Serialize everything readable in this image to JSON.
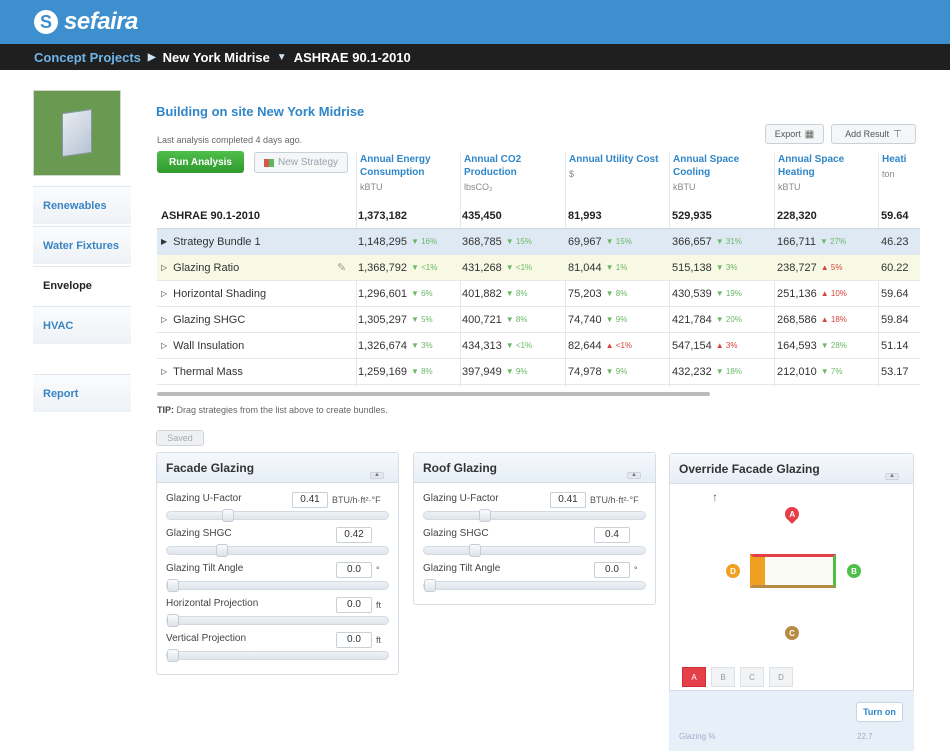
{
  "brand": {
    "name": "sefaira",
    "logo_glyph": "S"
  },
  "breadcrumb": {
    "root": "Concept Projects",
    "project": "New York Midrise",
    "standard": "ASHRAE 90.1-2010",
    "sep": "▶",
    "dropdown": "▼"
  },
  "sidebar": {
    "items": [
      {
        "label": "Renewables",
        "active": false
      },
      {
        "label": "Water Fixtures",
        "active": false
      },
      {
        "label": "Envelope",
        "active": true
      },
      {
        "label": "HVAC",
        "active": false
      },
      {
        "label": "Report",
        "active": false
      }
    ]
  },
  "main": {
    "title": "Building on site New York Midrise",
    "last_analysis": "Last analysis completed 4 days ago.",
    "run_button": "Run Analysis",
    "new_strategy_button": "New Strategy",
    "export_button": "Export",
    "add_result_button": "Add Result"
  },
  "columns": [
    {
      "title": "Annual Energy Consumption",
      "unit": "kBTU"
    },
    {
      "title": "Annual CO2 Production",
      "unit": "lbsCO₂"
    },
    {
      "title": "Annual Utility Cost",
      "unit": "$"
    },
    {
      "title": "Annual Space Cooling",
      "unit": "kBTU"
    },
    {
      "title": "Annual Space Heating",
      "unit": "kBTU"
    },
    {
      "title": "Heati",
      "unit": "ton"
    }
  ],
  "rows": [
    {
      "name": "ASHRAE 90.1-2010",
      "v": [
        "1,373,182",
        "435,450",
        "81,993",
        "529,935",
        "228,320",
        "59.64"
      ],
      "d": [
        "",
        "",
        "",
        "",
        "",
        ""
      ],
      "dir": [
        "",
        "",
        "",
        "",
        "",
        ""
      ]
    },
    {
      "name": "Strategy Bundle 1",
      "v": [
        "1,148,295",
        "368,785",
        "69,967",
        "366,657",
        "166,711",
        "46.23"
      ],
      "d": [
        "16%",
        "15%",
        "15%",
        "31%",
        "27%",
        ""
      ],
      "dir": [
        "up",
        "up",
        "up",
        "up",
        "up",
        ""
      ]
    },
    {
      "name": "Glazing Ratio",
      "v": [
        "1,368,792",
        "431,268",
        "81,044",
        "515,138",
        "238,727",
        "60.22"
      ],
      "d": [
        "<1%",
        "<1%",
        "1%",
        "3%",
        "5%",
        ""
      ],
      "dir": [
        "up",
        "up",
        "up",
        "up",
        "down",
        ""
      ]
    },
    {
      "name": "Horizontal Shading",
      "v": [
        "1,296,601",
        "401,882",
        "75,203",
        "430,539",
        "251,136",
        "59.64"
      ],
      "d": [
        "6%",
        "8%",
        "8%",
        "19%",
        "10%",
        ""
      ],
      "dir": [
        "up",
        "up",
        "up",
        "up",
        "down",
        ""
      ]
    },
    {
      "name": "Glazing SHGC",
      "v": [
        "1,305,297",
        "400,721",
        "74,740",
        "421,784",
        "268,586",
        "59.84"
      ],
      "d": [
        "5%",
        "8%",
        "9%",
        "20%",
        "18%",
        ""
      ],
      "dir": [
        "up",
        "up",
        "up",
        "up",
        "down",
        ""
      ]
    },
    {
      "name": "Wall Insulation",
      "v": [
        "1,326,674",
        "434,313",
        "82,644",
        "547,154",
        "164,593",
        "51.14"
      ],
      "d": [
        "3%",
        "<1%",
        "<1%",
        "3%",
        "28%",
        ""
      ],
      "dir": [
        "up",
        "up",
        "down",
        "down",
        "up",
        ""
      ]
    },
    {
      "name": "Thermal Mass",
      "v": [
        "1,259,169",
        "397,949",
        "74,978",
        "432,232",
        "212,010",
        "53.17"
      ],
      "d": [
        "8%",
        "9%",
        "9%",
        "18%",
        "7%",
        ""
      ],
      "dir": [
        "up",
        "up",
        "up",
        "up",
        "up",
        ""
      ]
    }
  ],
  "tip": {
    "label": "TIP:",
    "text": "Drag strategies from the list above to create bundles."
  },
  "saved_button": "Saved",
  "facade": {
    "title": "Facade Glazing",
    "fields": [
      {
        "label": "Glazing U-Factor",
        "value": "0.41",
        "unit": "BTU/h·ft²·°F",
        "slider_fraction": 0.27
      },
      {
        "label": "Glazing SHGC",
        "value": "0.42",
        "unit": "",
        "slider_fraction": 0.24
      },
      {
        "label": "Glazing Tilt Angle",
        "value": "0.0",
        "unit": "°",
        "slider_fraction": 0.0
      },
      {
        "label": "Horizontal Projection",
        "value": "0.0",
        "unit": "ft",
        "slider_fraction": 0.0
      },
      {
        "label": "Vertical Projection",
        "value": "0.0",
        "unit": "ft",
        "slider_fraction": 0.0
      }
    ]
  },
  "roof": {
    "title": "Roof Glazing",
    "fields": [
      {
        "label": "Glazing U-Factor",
        "value": "0.41",
        "unit": "BTU/h·ft²·°F",
        "slider_fraction": 0.27
      },
      {
        "label": "Glazing SHGC",
        "value": "0.4",
        "unit": "",
        "slider_fraction": 0.22
      },
      {
        "label": "Glazing Tilt Angle",
        "value": "0.0",
        "unit": "°",
        "slider_fraction": 0.0
      }
    ]
  },
  "override": {
    "title": "Override Facade Glazing",
    "north_glyph": "↑",
    "markers": [
      "A",
      "B",
      "C",
      "D"
    ],
    "tabs": [
      "A",
      "B",
      "C",
      "D"
    ],
    "active_tab": "A",
    "turn_button": "Turn on",
    "glazing_label": "Glazing %",
    "glazing_value": "22.7"
  },
  "colors": {
    "topbar": "#3d8fce",
    "accent": "#2f86c8",
    "run_green": "#3aa83a",
    "up_green": "#6bb865",
    "down_red": "#d8433b",
    "marker_red": "#e5404a",
    "marker_green": "#4fbf4a",
    "marker_orange": "#f0a020",
    "marker_tan": "#b88b42"
  }
}
